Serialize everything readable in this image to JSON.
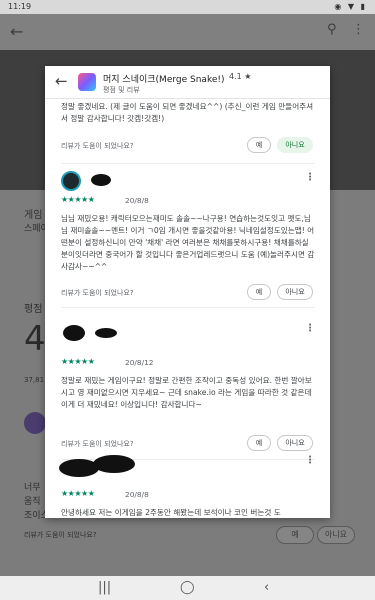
{
  "status": {
    "time": "11:19",
    "icons": "◉ ▼ ▮"
  },
  "background": {
    "back": "←",
    "search": "⚲",
    "more": "⋮",
    "section1": "게임",
    "section1b": "스페이",
    "section2": "평점",
    "big_rating": "4",
    "count": "37,81",
    "list1": "너무",
    "list2": "움직",
    "list3": "조이스",
    "helpful": "리뷰가 도움이 되었나요?",
    "yes": "예",
    "no": "아니요"
  },
  "dialog": {
    "back_icon": "←",
    "title": "머지 스네이크(Merge Snake!)",
    "rating": "4.1 ★",
    "subtitle": "평점 및 리뷰",
    "reviews": [
      {
        "text": "정말 좋겠네요. (제 글이 도움이 되면 좋겠네요^^) (추신_이런 게임 만들어주셔서 정말 감사합니다! 갓겜!갓겜!)",
        "helpful": "리뷰가 도움이 되었나요?",
        "yes": "예",
        "no": "아니요"
      },
      {
        "stars": "★★★★★",
        "date": "20/8/8",
        "text": "님님 재밌오용! 캐릭터모으는재미도 솔솔~~나구용! 연습하는것도잇고 펫도,님님 재미솔솔~~멘트! 이거 ㄱ0임 개시면 좋을것같아용! 닉네임설정도있는맵! 어떤분이 설정하신니이 만약 '채채' 라면 여러분은 채채를못하시구용! 채채를하실분이잇더라면 중국어가 할 것입니다 좋은거업레드랫으니 도움 (예)놀러주시면 감사감사~~^^",
        "helpful": "리뷰가 도움이 되었나요?",
        "yes": "예",
        "no": "아니요"
      },
      {
        "stars": "★★★★★",
        "date": "20/8/12",
        "text": "정말로 재밌는 게임이구요! 정말로 간편한 조작이고 중독성 있어요. 한번 깔아보시고 영 재미없으시면 지우세요~ 근데 snake.io 라는 게임을 따라한 것 같은데 이게 더 재밌네요! 이상입니다! 감사합니다~",
        "helpful": "리뷰가 도움이 되었나요?",
        "yes": "예",
        "no": "아니요"
      },
      {
        "stars": "★★★★★",
        "date": "20/8/8",
        "text": "안녕하세요 저는 이게임을 2주동안 해봤는데 보석이나 코인 버는것 도"
      }
    ]
  },
  "nav": {
    "recents": "|||",
    "home": "◯",
    "back": "‹"
  }
}
